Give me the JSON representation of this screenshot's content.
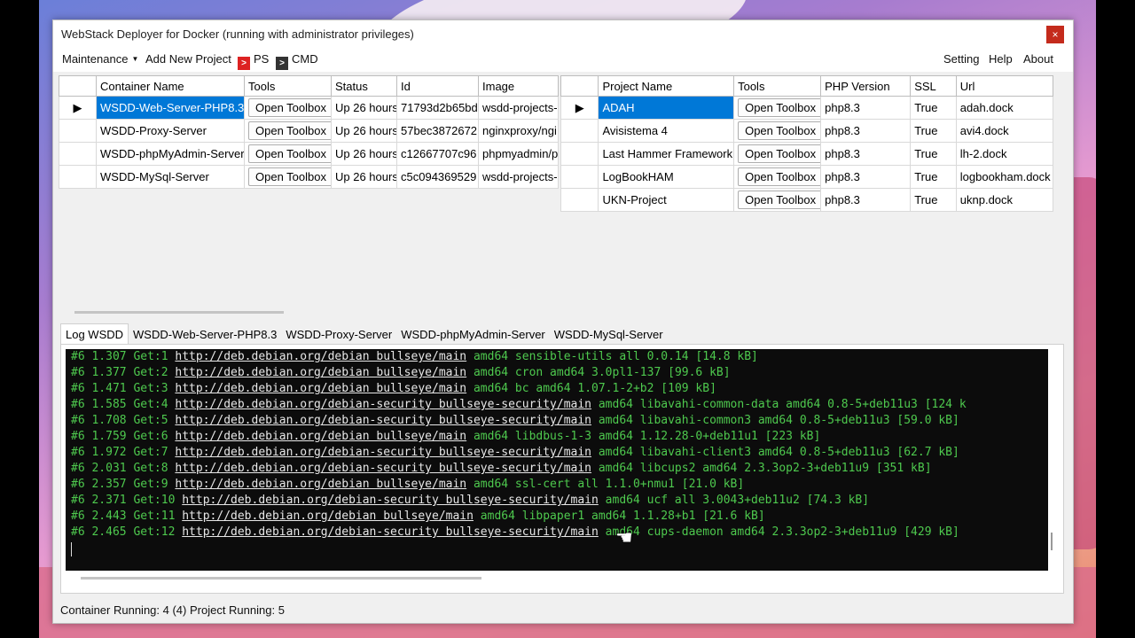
{
  "window": {
    "title": "WebStack Deployer for Docker (running with administrator privileges)",
    "close": "×"
  },
  "menu": {
    "maintenance": "Maintenance",
    "add_project": "Add New Project",
    "ps": "PS",
    "cmd": "CMD",
    "setting": "Setting",
    "help": "Help",
    "about": "About"
  },
  "containers": {
    "headers": [
      "Container Name",
      "Tools",
      "Status",
      "Id",
      "Image"
    ],
    "rows": [
      {
        "name": "WSDD-Web-Server-PHP8.3",
        "tools": "Open Toolbox",
        "status": "Up 26 hours",
        "id": "71793d2b65bd",
        "image": "wsdd-projects-"
      },
      {
        "name": "WSDD-Proxy-Server",
        "tools": "Open Toolbox",
        "status": "Up 26 hours",
        "id": "57bec3872672",
        "image": "nginxproxy/ngi"
      },
      {
        "name": "WSDD-phpMyAdmin-Server",
        "tools": "Open Toolbox",
        "status": "Up 26 hours",
        "id": "c12667707c96",
        "image": "phpmyadmin/p"
      },
      {
        "name": "WSDD-MySql-Server",
        "tools": "Open Toolbox",
        "status": "Up 26 hours",
        "id": "c5c094369529",
        "image": "wsdd-projects-"
      }
    ]
  },
  "projects": {
    "headers": [
      "Project Name",
      "Tools",
      "PHP Version",
      "SSL",
      "Url"
    ],
    "rows": [
      {
        "name": "ADAH",
        "tools": "Open Toolbox",
        "php": "php8.3",
        "ssl": "True",
        "url": "adah.dock"
      },
      {
        "name": "Avisistema 4",
        "tools": "Open Toolbox",
        "php": "php8.3",
        "ssl": "True",
        "url": "avi4.dock"
      },
      {
        "name": "Last Hammer Framework",
        "tools": "Open Toolbox",
        "php": "php8.3",
        "ssl": "True",
        "url": "lh-2.dock"
      },
      {
        "name": "LogBookHAM",
        "tools": "Open Toolbox",
        "php": "php8.3",
        "ssl": "True",
        "url": "logbookham.dock"
      },
      {
        "name": "UKN-Project",
        "tools": "Open Toolbox",
        "php": "php8.3",
        "ssl": "True",
        "url": "uknp.dock"
      }
    ]
  },
  "tabs": [
    "Log WSDD",
    "WSDD-Web-Server-PHP8.3",
    "WSDD-Proxy-Server",
    "WSDD-phpMyAdmin-Server",
    "WSDD-MySql-Server"
  ],
  "log": [
    {
      "pre": "#6 1.307 Get:1 ",
      "url": "http://deb.debian.org/debian bullseye/main",
      "post": " amd64 sensible-utils all 0.0.14 [14.8 kB]"
    },
    {
      "pre": "#6 1.377 Get:2 ",
      "url": "http://deb.debian.org/debian bullseye/main",
      "post": " amd64 cron amd64 3.0pl1-137 [99.6 kB]"
    },
    {
      "pre": "#6 1.471 Get:3 ",
      "url": "http://deb.debian.org/debian bullseye/main",
      "post": " amd64 bc amd64 1.07.1-2+b2 [109 kB]"
    },
    {
      "pre": "#6 1.585 Get:4 ",
      "url": "http://deb.debian.org/debian-security bullseye-security/main",
      "post": " amd64 libavahi-common-data amd64 0.8-5+deb11u3 [124 k"
    },
    {
      "pre": "#6 1.708 Get:5 ",
      "url": "http://deb.debian.org/debian-security bullseye-security/main",
      "post": " amd64 libavahi-common3 amd64 0.8-5+deb11u3 [59.0 kB]"
    },
    {
      "pre": "#6 1.759 Get:6 ",
      "url": "http://deb.debian.org/debian bullseye/main",
      "post": " amd64 libdbus-1-3 amd64 1.12.28-0+deb11u1 [223 kB]"
    },
    {
      "pre": "#6 1.972 Get:7 ",
      "url": "http://deb.debian.org/debian-security bullseye-security/main",
      "post": " amd64 libavahi-client3 amd64 0.8-5+deb11u3 [62.7 kB]"
    },
    {
      "pre": "#6 2.031 Get:8 ",
      "url": "http://deb.debian.org/debian-security bullseye-security/main",
      "post": " amd64 libcups2 amd64 2.3.3op2-3+deb11u9 [351 kB]"
    },
    {
      "pre": "#6 2.357 Get:9 ",
      "url": "http://deb.debian.org/debian bullseye/main",
      "post": " amd64 ssl-cert all 1.1.0+nmu1 [21.0 kB]"
    },
    {
      "pre": "#6 2.371 Get:10 ",
      "url": "http://deb.debian.org/debian-security bullseye-security/main",
      "post": " amd64 ucf all 3.0043+deb11u2 [74.3 kB]"
    },
    {
      "pre": "#6 2.443 Get:11 ",
      "url": "http://deb.debian.org/debian bullseye/main",
      "post": " amd64 libpaper1 amd64 1.1.28+b1 [21.6 kB]"
    },
    {
      "pre": "#6 2.465 Get:12 ",
      "url": "http://deb.debian.org/debian-security bullseye-security/main",
      "post": " amd64 cups-daemon amd64 2.3.3op2-3+deb11u9 [429 kB]"
    }
  ],
  "status": "Container Running: 4 (4)  Project Running: 5"
}
